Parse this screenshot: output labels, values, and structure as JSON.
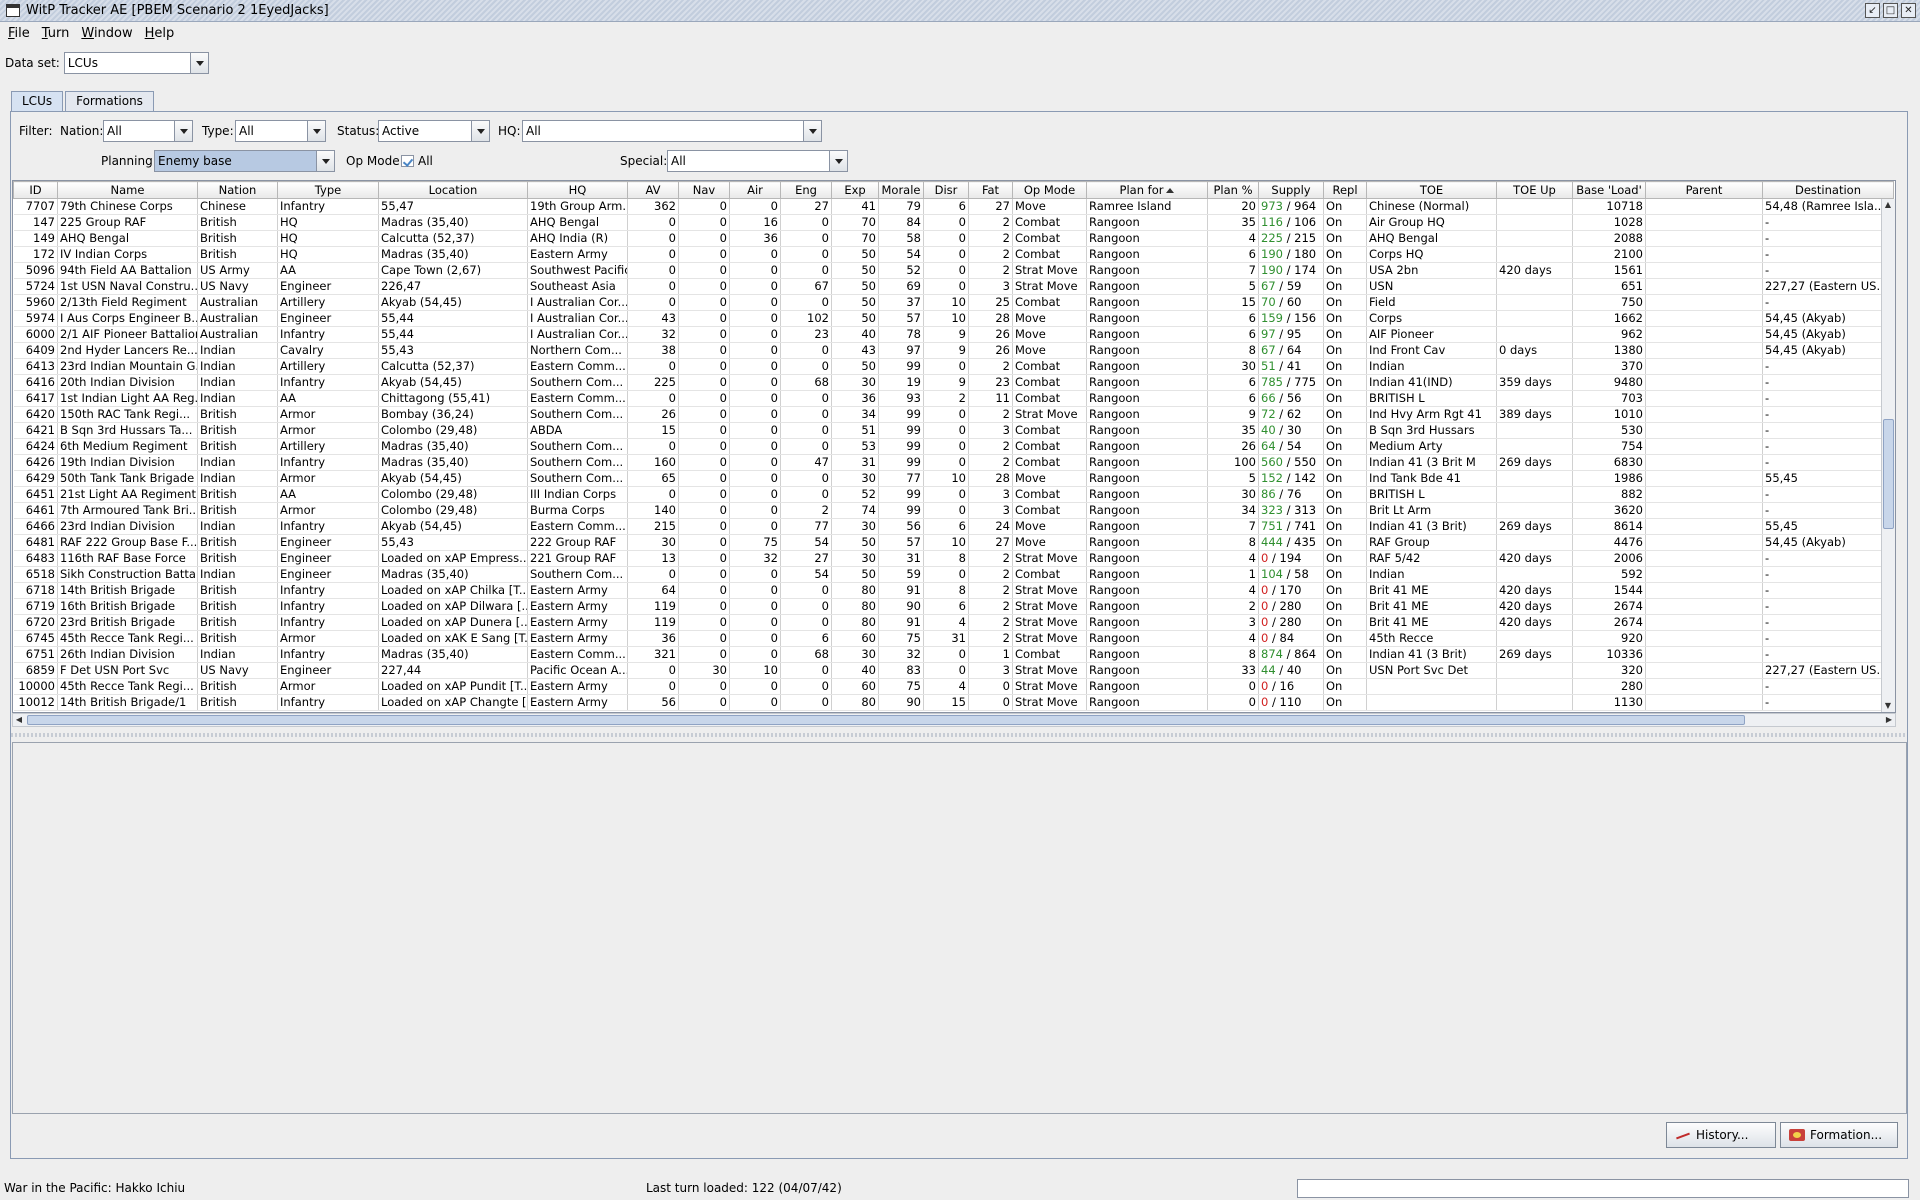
{
  "window": {
    "title": "WitP Tracker AE [PBEM Scenario 2 1EyedJacks]"
  },
  "menu": [
    {
      "label": "File",
      "u": "F",
      "rest": "ile"
    },
    {
      "label": "Turn",
      "u": "T",
      "rest": "urn"
    },
    {
      "label": "Window",
      "u": "W",
      "rest": "indow"
    },
    {
      "label": "Help",
      "u": "H",
      "rest": "elp"
    }
  ],
  "dataset": {
    "label": "Data set:",
    "value": "LCUs"
  },
  "tabs": [
    {
      "label": "LCUs",
      "active": true
    },
    {
      "label": "Formations",
      "active": false
    }
  ],
  "filters": {
    "filter_label": "Filter:",
    "nation_label": "Nation:",
    "nation_value": "All",
    "type_label": "Type:",
    "type_value": "All",
    "status_label": "Status:",
    "status_value": "Active",
    "hq_label": "HQ:",
    "hq_value": "All",
    "planning_label": "Planning:",
    "planning_value": "Enemy base",
    "opmode_label": "Op Mode:",
    "opmode_value": "All",
    "special_label": "Special:",
    "special_value": "All"
  },
  "columns": [
    "ID",
    "Name",
    "Nation",
    "Type",
    "Location",
    "HQ",
    "AV",
    "Nav",
    "Air",
    "Eng",
    "Exp",
    "Morale",
    "Disr",
    "Fat",
    "Op Mode",
    "Plan for",
    "Plan %",
    "Supply",
    "Repl",
    "TOE",
    "TOE Up",
    "Base 'Load'",
    "Parent",
    "Destination"
  ],
  "sorted_column": "Plan for",
  "rows": [
    [
      "7707",
      "79th Chinese Corps",
      "Chinese",
      "Infantry",
      "55,47",
      "19th Group Arm...",
      "362",
      "0",
      "0",
      "27",
      "41",
      "79",
      "6",
      "27",
      "Move",
      "Ramree Island",
      "20",
      "973",
      "964",
      "On",
      "Chinese (Normal)",
      "",
      "10718",
      "",
      "54,48 (Ramree Isla..."
    ],
    [
      "147",
      "225 Group RAF",
      "British",
      "HQ",
      "Madras (35,40)",
      "AHQ Bengal",
      "0",
      "0",
      "16",
      "0",
      "70",
      "84",
      "0",
      "2",
      "Combat",
      "Rangoon",
      "35",
      "116",
      "106",
      "On",
      "Air Group HQ",
      "",
      "1028",
      "",
      "-"
    ],
    [
      "149",
      "AHQ Bengal",
      "British",
      "HQ",
      "Calcutta (52,37)",
      "AHQ India (R)",
      "0",
      "0",
      "36",
      "0",
      "70",
      "58",
      "0",
      "2",
      "Combat",
      "Rangoon",
      "4",
      "225",
      "215",
      "On",
      "AHQ Bengal",
      "",
      "2088",
      "",
      "-"
    ],
    [
      "172",
      "IV Indian Corps",
      "British",
      "HQ",
      "Madras (35,40)",
      "Eastern Army",
      "0",
      "0",
      "0",
      "0",
      "50",
      "54",
      "0",
      "2",
      "Combat",
      "Rangoon",
      "6",
      "190",
      "180",
      "On",
      "Corps HQ",
      "",
      "2100",
      "",
      "-"
    ],
    [
      "5096",
      "94th Field AA Battalion",
      "US Army",
      "AA",
      "Cape Town (2,67)",
      "Southwest Pacific",
      "0",
      "0",
      "0",
      "0",
      "50",
      "52",
      "0",
      "2",
      "Strat Move",
      "Rangoon",
      "7",
      "190",
      "174",
      "On",
      "USA 2bn",
      "420 days",
      "1561",
      "",
      "-"
    ],
    [
      "5724",
      "1st USN Naval Constru...",
      "US Navy",
      "Engineer",
      "226,47",
      "Southeast Asia",
      "0",
      "0",
      "0",
      "67",
      "50",
      "69",
      "0",
      "3",
      "Strat Move",
      "Rangoon",
      "5",
      "67",
      "59",
      "On",
      "USN",
      "",
      "651",
      "",
      "227,27 (Eastern US..."
    ],
    [
      "5960",
      "2/13th Field Regiment",
      "Australian",
      "Artillery",
      "Akyab (54,45)",
      "I Australian Cor...",
      "0",
      "0",
      "0",
      "0",
      "50",
      "37",
      "10",
      "25",
      "Combat",
      "Rangoon",
      "15",
      "70",
      "60",
      "On",
      "Field",
      "",
      "750",
      "",
      "-"
    ],
    [
      "5974",
      "I Aus Corps Engineer B...",
      "Australian",
      "Engineer",
      "55,44",
      "I Australian Cor...",
      "43",
      "0",
      "0",
      "102",
      "50",
      "57",
      "10",
      "28",
      "Move",
      "Rangoon",
      "6",
      "159",
      "156",
      "On",
      "Corps",
      "",
      "1662",
      "",
      "54,45 (Akyab)"
    ],
    [
      "6000",
      "2/1 AIF Pioneer Battalion",
      "Australian",
      "Infantry",
      "55,44",
      "I Australian Cor...",
      "32",
      "0",
      "0",
      "23",
      "40",
      "78",
      "9",
      "26",
      "Move",
      "Rangoon",
      "6",
      "97",
      "95",
      "On",
      "AIF Pioneer",
      "",
      "962",
      "",
      "54,45 (Akyab)"
    ],
    [
      "6409",
      "2nd Hyder Lancers Re...",
      "Indian",
      "Cavalry",
      "55,43",
      "Northern Com...",
      "38",
      "0",
      "0",
      "0",
      "43",
      "97",
      "9",
      "26",
      "Move",
      "Rangoon",
      "8",
      "67",
      "64",
      "On",
      "Ind Front Cav",
      "0 days",
      "1380",
      "",
      "54,45 (Akyab)"
    ],
    [
      "6413",
      "23rd Indian Mountain G...",
      "Indian",
      "Artillery",
      "Calcutta (52,37)",
      "Eastern Comm...",
      "0",
      "0",
      "0",
      "0",
      "50",
      "99",
      "0",
      "2",
      "Combat",
      "Rangoon",
      "30",
      "51",
      "41",
      "On",
      "Indian",
      "",
      "370",
      "",
      "-"
    ],
    [
      "6416",
      "20th Indian Division",
      "Indian",
      "Infantry",
      "Akyab (54,45)",
      "Southern Com...",
      "225",
      "0",
      "0",
      "68",
      "30",
      "19",
      "9",
      "23",
      "Combat",
      "Rangoon",
      "6",
      "785",
      "775",
      "On",
      "Indian 41(IND)",
      "359 days",
      "9480",
      "",
      "-"
    ],
    [
      "6417",
      "1st Indian Light AA Reg...",
      "Indian",
      "AA",
      "Chittagong (55,41)",
      "Eastern Comm...",
      "0",
      "0",
      "0",
      "0",
      "36",
      "93",
      "2",
      "11",
      "Combat",
      "Rangoon",
      "6",
      "66",
      "56",
      "On",
      "BRITISH L",
      "",
      "703",
      "",
      "-"
    ],
    [
      "6420",
      "150th RAC Tank Regi...",
      "British",
      "Armor",
      "Bombay (36,24)",
      "Southern Com...",
      "26",
      "0",
      "0",
      "0",
      "34",
      "99",
      "0",
      "2",
      "Strat Move",
      "Rangoon",
      "9",
      "72",
      "62",
      "On",
      "Ind Hvy Arm Rgt 41",
      "389 days",
      "1010",
      "",
      "-"
    ],
    [
      "6421",
      "B Sqn 3rd Hussars Ta...",
      "British",
      "Armor",
      "Colombo (29,48)",
      "ABDA",
      "15",
      "0",
      "0",
      "0",
      "51",
      "99",
      "0",
      "3",
      "Combat",
      "Rangoon",
      "35",
      "40",
      "30",
      "On",
      "B Sqn 3rd Hussars",
      "",
      "530",
      "",
      "-"
    ],
    [
      "6424",
      "6th Medium Regiment",
      "British",
      "Artillery",
      "Madras (35,40)",
      "Southern Com...",
      "0",
      "0",
      "0",
      "0",
      "53",
      "99",
      "0",
      "2",
      "Combat",
      "Rangoon",
      "26",
      "64",
      "54",
      "On",
      "Medium Arty",
      "",
      "754",
      "",
      "-"
    ],
    [
      "6426",
      "19th Indian Division",
      "Indian",
      "Infantry",
      "Madras (35,40)",
      "Southern Com...",
      "160",
      "0",
      "0",
      "47",
      "31",
      "99",
      "0",
      "2",
      "Combat",
      "Rangoon",
      "100",
      "560",
      "550",
      "On",
      "Indian 41 (3 Brit M",
      "269 days",
      "6830",
      "",
      "-"
    ],
    [
      "6429",
      "50th Tank Tank Brigade",
      "Indian",
      "Armor",
      "Akyab (54,45)",
      "Southern Com...",
      "65",
      "0",
      "0",
      "0",
      "30",
      "77",
      "10",
      "28",
      "Move",
      "Rangoon",
      "5",
      "152",
      "142",
      "On",
      "Ind Tank Bde 41",
      "",
      "1986",
      "",
      "55,45"
    ],
    [
      "6451",
      "21st Light AA Regiment",
      "British",
      "AA",
      "Colombo (29,48)",
      "III Indian Corps",
      "0",
      "0",
      "0",
      "0",
      "52",
      "99",
      "0",
      "3",
      "Combat",
      "Rangoon",
      "30",
      "86",
      "76",
      "On",
      "BRITISH L",
      "",
      "882",
      "",
      "-"
    ],
    [
      "6461",
      "7th Armoured Tank Bri...",
      "British",
      "Armor",
      "Colombo (29,48)",
      "Burma Corps",
      "140",
      "0",
      "0",
      "2",
      "74",
      "99",
      "0",
      "3",
      "Combat",
      "Rangoon",
      "34",
      "323",
      "313",
      "On",
      "Brit Lt Arm",
      "",
      "3620",
      "",
      "-"
    ],
    [
      "6466",
      "23rd Indian Division",
      "Indian",
      "Infantry",
      "Akyab (54,45)",
      "Eastern Comm...",
      "215",
      "0",
      "0",
      "77",
      "30",
      "56",
      "6",
      "24",
      "Move",
      "Rangoon",
      "7",
      "751",
      "741",
      "On",
      "Indian 41 (3 Brit)",
      "269 days",
      "8614",
      "",
      "55,45"
    ],
    [
      "6481",
      "RAF 222 Group Base F...",
      "British",
      "Engineer",
      "55,43",
      "222 Group RAF",
      "30",
      "0",
      "75",
      "54",
      "50",
      "57",
      "10",
      "27",
      "Move",
      "Rangoon",
      "8",
      "444",
      "435",
      "On",
      "RAF Group",
      "",
      "4476",
      "",
      "54,45 (Akyab)"
    ],
    [
      "6483",
      "116th RAF Base Force",
      "British",
      "Engineer",
      "Loaded on xAP Empress...",
      "221 Group RAF",
      "13",
      "0",
      "32",
      "27",
      "30",
      "31",
      "8",
      "2",
      "Strat Move",
      "Rangoon",
      "4",
      "0",
      "194",
      "On",
      "RAF 5/42",
      "420 days",
      "2006",
      "",
      "-"
    ],
    [
      "6518",
      "Sikh Construction Batta...",
      "Indian",
      "Engineer",
      "Madras (35,40)",
      "Southern Com...",
      "0",
      "0",
      "0",
      "54",
      "50",
      "59",
      "0",
      "2",
      "Combat",
      "Rangoon",
      "1",
      "104",
      "58",
      "On",
      "Indian",
      "",
      "592",
      "",
      "-"
    ],
    [
      "6718",
      "14th British Brigade",
      "British",
      "Infantry",
      "Loaded on xAP Chilka [T...",
      "Eastern Army",
      "64",
      "0",
      "0",
      "0",
      "80",
      "91",
      "8",
      "2",
      "Strat Move",
      "Rangoon",
      "4",
      "0",
      "170",
      "On",
      "Brit 41 ME",
      "420 days",
      "1544",
      "",
      "-"
    ],
    [
      "6719",
      "16th British Brigade",
      "British",
      "Infantry",
      "Loaded on xAP Dilwara [...",
      "Eastern Army",
      "119",
      "0",
      "0",
      "0",
      "80",
      "90",
      "6",
      "2",
      "Strat Move",
      "Rangoon",
      "2",
      "0",
      "280",
      "On",
      "Brit 41 ME",
      "420 days",
      "2674",
      "",
      "-"
    ],
    [
      "6720",
      "23rd British Brigade",
      "British",
      "Infantry",
      "Loaded on xAP Dunera [...",
      "Eastern Army",
      "119",
      "0",
      "0",
      "0",
      "80",
      "91",
      "4",
      "2",
      "Strat Move",
      "Rangoon",
      "3",
      "0",
      "280",
      "On",
      "Brit 41 ME",
      "420 days",
      "2674",
      "",
      "-"
    ],
    [
      "6745",
      "45th Recce Tank Regi...",
      "British",
      "Armor",
      "Loaded on xAK E Sang [T...",
      "Eastern Army",
      "36",
      "0",
      "0",
      "6",
      "60",
      "75",
      "31",
      "2",
      "Strat Move",
      "Rangoon",
      "4",
      "0",
      "84",
      "On",
      "45th Recce",
      "",
      "920",
      "",
      "-"
    ],
    [
      "6751",
      "26th Indian Division",
      "Indian",
      "Infantry",
      "Madras (35,40)",
      "Eastern Comm...",
      "321",
      "0",
      "0",
      "68",
      "30",
      "32",
      "0",
      "1",
      "Combat",
      "Rangoon",
      "8",
      "874",
      "864",
      "On",
      "Indian 41 (3 Brit)",
      "269 days",
      "10336",
      "",
      "-"
    ],
    [
      "6859",
      "F Det USN Port Svc",
      "US Navy",
      "Engineer",
      "227,44",
      "Pacific Ocean A...",
      "0",
      "30",
      "10",
      "0",
      "40",
      "83",
      "0",
      "3",
      "Strat Move",
      "Rangoon",
      "33",
      "44",
      "40",
      "On",
      "USN Port Svc Det",
      "",
      "320",
      "",
      "227,27 (Eastern US..."
    ],
    [
      "10000",
      "45th Recce Tank Regi...",
      "British",
      "Armor",
      "Loaded on xAP Pundit [T...",
      "Eastern Army",
      "0",
      "0",
      "0",
      "0",
      "60",
      "75",
      "4",
      "0",
      "Strat Move",
      "Rangoon",
      "0",
      "0",
      "16",
      "On",
      "",
      "",
      "280",
      "",
      "-"
    ],
    [
      "10012",
      "14th British Brigade/1",
      "British",
      "Infantry",
      "Loaded on xAP Changte [...",
      "Eastern Army",
      "56",
      "0",
      "0",
      "0",
      "80",
      "90",
      "15",
      "0",
      "Strat Move",
      "Rangoon",
      "0",
      "0",
      "110",
      "On",
      "",
      "",
      "1130",
      "",
      "-"
    ]
  ],
  "buttons": {
    "history": "History...",
    "formation": "Formation..."
  },
  "status": {
    "left": "War in the Pacific: Hakko Ichiu",
    "middle": "Last turn loaded: 122 (04/07/42)"
  },
  "colors": {
    "supply_ok": "#2f8f2f",
    "supply_low": "#d02020",
    "selection": "#b7c9e2"
  }
}
